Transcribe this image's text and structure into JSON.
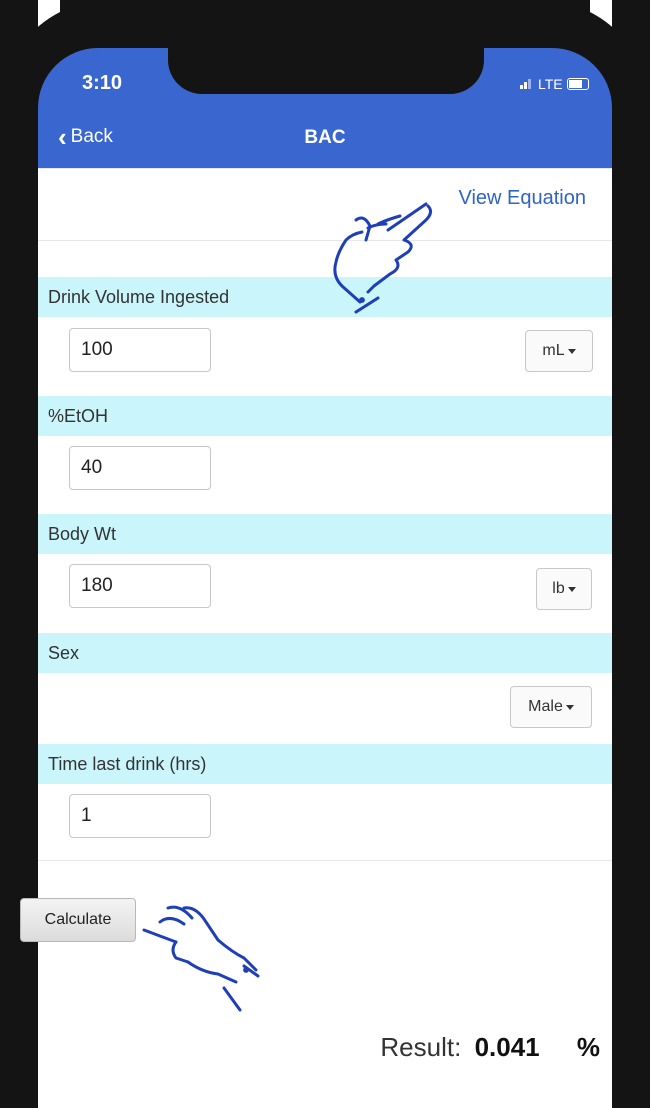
{
  "status_bar": {
    "time": "3:10",
    "network": "LTE"
  },
  "nav": {
    "back_label": "Back",
    "title": "BAC"
  },
  "view_equation": "View Equation",
  "fields": {
    "drink_volume": {
      "label": "Drink Volume Ingested",
      "value": "100",
      "unit": "mL"
    },
    "etoh": {
      "label": "%EtOH",
      "value": "40"
    },
    "body_wt": {
      "label": "Body Wt",
      "value": "180",
      "unit": "lb"
    },
    "sex": {
      "label": "Sex",
      "value": "Male"
    },
    "time_last_drink": {
      "label": "Time last drink (hrs)",
      "value": "1"
    }
  },
  "calculate_label": "Calculate",
  "result": {
    "label": "Result:",
    "value": "0.041",
    "unit": "%"
  },
  "colors": {
    "nav_blue": "#3a66cf",
    "band_cyan": "#c9f5fb",
    "link_blue": "#2f63c8",
    "hand_blue": "#1f3fb8"
  },
  "icons": [
    "back-chevron-icon",
    "signal-icon",
    "battery-icon",
    "dropdown-caret-icon",
    "pointing-hand-icon"
  ]
}
